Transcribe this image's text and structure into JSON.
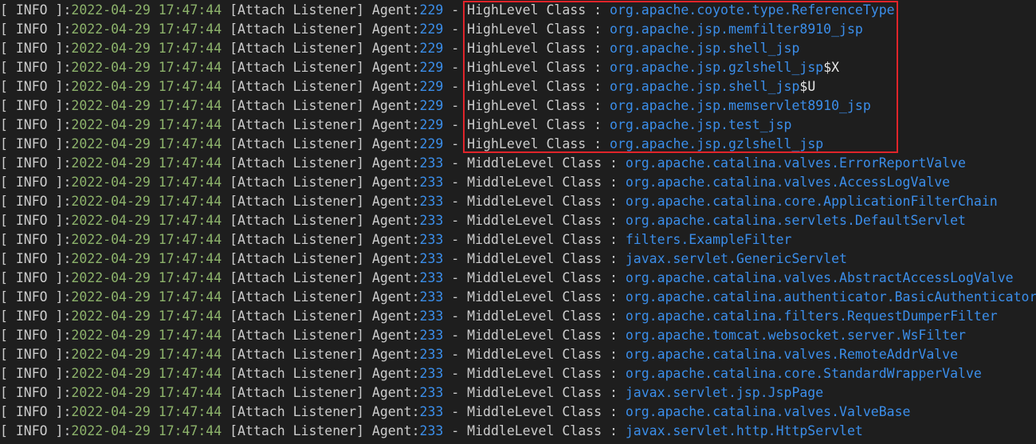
{
  "colors": {
    "background": "#1e1e1e",
    "text": "#cccccc",
    "timestamp": "#8db36b",
    "agent_id": "#3b8eea",
    "class_name": "#3b8eea",
    "highlight_border": "#e0242a"
  },
  "log_lines": [
    {
      "level": "[ INFO ]",
      "sep": ":",
      "timestamp": "2022-04-29 17:47:44",
      "source": " [Attach Listener] Agent:",
      "agent": "229",
      "kind": " - HighLevel Class : ",
      "class_name": "org.apache.coyote.type.ReferenceType",
      "suffix": ""
    },
    {
      "level": "[ INFO ]",
      "sep": ":",
      "timestamp": "2022-04-29 17:47:44",
      "source": " [Attach Listener] Agent:",
      "agent": "229",
      "kind": " - HighLevel Class : ",
      "class_name": "org.apache.jsp.memfilter8910_jsp",
      "suffix": ""
    },
    {
      "level": "[ INFO ]",
      "sep": ":",
      "timestamp": "2022-04-29 17:47:44",
      "source": " [Attach Listener] Agent:",
      "agent": "229",
      "kind": " - HighLevel Class : ",
      "class_name": "org.apache.jsp.shell_jsp",
      "suffix": ""
    },
    {
      "level": "[ INFO ]",
      "sep": ":",
      "timestamp": "2022-04-29 17:47:44",
      "source": " [Attach Listener] Agent:",
      "agent": "229",
      "kind": " - HighLevel Class : ",
      "class_name": "org.apache.jsp.gzlshell_jsp",
      "suffix": "$X"
    },
    {
      "level": "[ INFO ]",
      "sep": ":",
      "timestamp": "2022-04-29 17:47:44",
      "source": " [Attach Listener] Agent:",
      "agent": "229",
      "kind": " - HighLevel Class : ",
      "class_name": "org.apache.jsp.shell_jsp",
      "suffix": "$U"
    },
    {
      "level": "[ INFO ]",
      "sep": ":",
      "timestamp": "2022-04-29 17:47:44",
      "source": " [Attach Listener] Agent:",
      "agent": "229",
      "kind": " - HighLevel Class : ",
      "class_name": "org.apache.jsp.memservlet8910_jsp",
      "suffix": ""
    },
    {
      "level": "[ INFO ]",
      "sep": ":",
      "timestamp": "2022-04-29 17:47:44",
      "source": " [Attach Listener] Agent:",
      "agent": "229",
      "kind": " - HighLevel Class : ",
      "class_name": "org.apache.jsp.test_jsp",
      "suffix": ""
    },
    {
      "level": "[ INFO ]",
      "sep": ":",
      "timestamp": "2022-04-29 17:47:44",
      "source": " [Attach Listener] Agent:",
      "agent": "229",
      "kind": " - HighLevel Class : ",
      "class_name": "org.apache.jsp.gzlshell_jsp",
      "suffix": ""
    },
    {
      "level": "[ INFO ]",
      "sep": ":",
      "timestamp": "2022-04-29 17:47:44",
      "source": " [Attach Listener] Agent:",
      "agent": "233",
      "kind": " - MiddleLevel Class : ",
      "class_name": "org.apache.catalina.valves.ErrorReportValve",
      "suffix": ""
    },
    {
      "level": "[ INFO ]",
      "sep": ":",
      "timestamp": "2022-04-29 17:47:44",
      "source": " [Attach Listener] Agent:",
      "agent": "233",
      "kind": " - MiddleLevel Class : ",
      "class_name": "org.apache.catalina.valves.AccessLogValve",
      "suffix": ""
    },
    {
      "level": "[ INFO ]",
      "sep": ":",
      "timestamp": "2022-04-29 17:47:44",
      "source": " [Attach Listener] Agent:",
      "agent": "233",
      "kind": " - MiddleLevel Class : ",
      "class_name": "org.apache.catalina.core.ApplicationFilterChain",
      "suffix": ""
    },
    {
      "level": "[ INFO ]",
      "sep": ":",
      "timestamp": "2022-04-29 17:47:44",
      "source": " [Attach Listener] Agent:",
      "agent": "233",
      "kind": " - MiddleLevel Class : ",
      "class_name": "org.apache.catalina.servlets.DefaultServlet",
      "suffix": ""
    },
    {
      "level": "[ INFO ]",
      "sep": ":",
      "timestamp": "2022-04-29 17:47:44",
      "source": " [Attach Listener] Agent:",
      "agent": "233",
      "kind": " - MiddleLevel Class : ",
      "class_name": "filters.ExampleFilter",
      "suffix": ""
    },
    {
      "level": "[ INFO ]",
      "sep": ":",
      "timestamp": "2022-04-29 17:47:44",
      "source": " [Attach Listener] Agent:",
      "agent": "233",
      "kind": " - MiddleLevel Class : ",
      "class_name": "javax.servlet.GenericServlet",
      "suffix": ""
    },
    {
      "level": "[ INFO ]",
      "sep": ":",
      "timestamp": "2022-04-29 17:47:44",
      "source": " [Attach Listener] Agent:",
      "agent": "233",
      "kind": " - MiddleLevel Class : ",
      "class_name": "org.apache.catalina.valves.AbstractAccessLogValve",
      "suffix": ""
    },
    {
      "level": "[ INFO ]",
      "sep": ":",
      "timestamp": "2022-04-29 17:47:44",
      "source": " [Attach Listener] Agent:",
      "agent": "233",
      "kind": " - MiddleLevel Class : ",
      "class_name": "org.apache.catalina.authenticator.BasicAuthenticator",
      "suffix": ""
    },
    {
      "level": "[ INFO ]",
      "sep": ":",
      "timestamp": "2022-04-29 17:47:44",
      "source": " [Attach Listener] Agent:",
      "agent": "233",
      "kind": " - MiddleLevel Class : ",
      "class_name": "org.apache.catalina.filters.RequestDumperFilter",
      "suffix": ""
    },
    {
      "level": "[ INFO ]",
      "sep": ":",
      "timestamp": "2022-04-29 17:47:44",
      "source": " [Attach Listener] Agent:",
      "agent": "233",
      "kind": " - MiddleLevel Class : ",
      "class_name": "org.apache.tomcat.websocket.server.WsFilter",
      "suffix": ""
    },
    {
      "level": "[ INFO ]",
      "sep": ":",
      "timestamp": "2022-04-29 17:47:44",
      "source": " [Attach Listener] Agent:",
      "agent": "233",
      "kind": " - MiddleLevel Class : ",
      "class_name": "org.apache.catalina.valves.RemoteAddrValve",
      "suffix": ""
    },
    {
      "level": "[ INFO ]",
      "sep": ":",
      "timestamp": "2022-04-29 17:47:44",
      "source": " [Attach Listener] Agent:",
      "agent": "233",
      "kind": " - MiddleLevel Class : ",
      "class_name": "org.apache.catalina.core.StandardWrapperValve",
      "suffix": ""
    },
    {
      "level": "[ INFO ]",
      "sep": ":",
      "timestamp": "2022-04-29 17:47:44",
      "source": " [Attach Listener] Agent:",
      "agent": "233",
      "kind": " - MiddleLevel Class : ",
      "class_name": "javax.servlet.jsp.JspPage",
      "suffix": ""
    },
    {
      "level": "[ INFO ]",
      "sep": ":",
      "timestamp": "2022-04-29 17:47:44",
      "source": " [Attach Listener] Agent:",
      "agent": "233",
      "kind": " - MiddleLevel Class : ",
      "class_name": "org.apache.catalina.valves.ValveBase",
      "suffix": ""
    },
    {
      "level": "[ INFO ]",
      "sep": ":",
      "timestamp": "2022-04-29 17:47:44",
      "source": " [Attach Listener] Agent:",
      "agent": "233",
      "kind": " - MiddleLevel Class : ",
      "class_name": "javax.servlet.http.HttpServlet",
      "suffix": ""
    }
  ]
}
